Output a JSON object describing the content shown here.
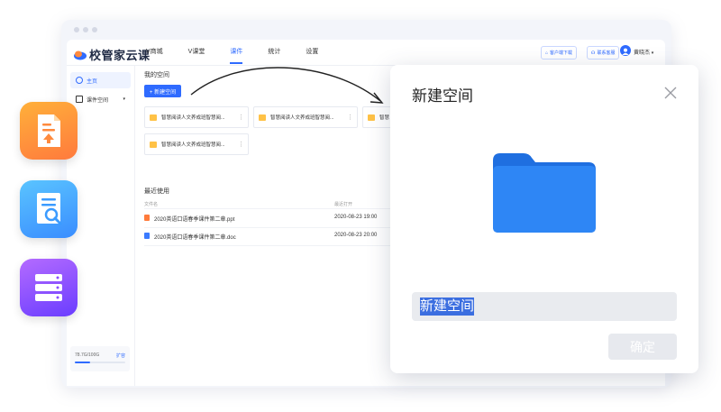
{
  "app": {
    "logo_text": "校管家云课",
    "nav": [
      "V商城",
      "V课堂",
      "课件",
      "统计",
      "设置"
    ],
    "active_nav": "课件",
    "header_buttons": {
      "download": "客户端下载",
      "contact": "联系客服"
    },
    "user_name": "黄晓杰"
  },
  "sidebar": {
    "items": [
      {
        "label": "主页",
        "active": true
      },
      {
        "label": "课件空间",
        "active": false,
        "caret": "▾"
      }
    ],
    "storage": {
      "text": "78.7G/100G",
      "link": "扩容",
      "used_fraction": 0.3
    }
  },
  "main": {
    "my_space_title": "我的空间",
    "new_space_button": "+ 新建空间",
    "cards": [
      {
        "name": "智慧阅读人文养成班智慧阅...",
        "more": "⋮"
      },
      {
        "name": "智慧阅读人文养成班智慧阅...",
        "more": "⋮"
      },
      {
        "name": "智慧",
        "more": ""
      },
      {
        "name": "智慧阅读人文养成班智慧阅...",
        "more": "⋮"
      }
    ],
    "recent_title": "最近使用",
    "columns": {
      "file_name": "文件名",
      "last_opened": "最近打开"
    },
    "recent_files": [
      {
        "name": "2020英语口语春季课件第二章.ppt",
        "time": "2020-08-23  19:00",
        "type": "ppt"
      },
      {
        "name": "2020英语口语春季课件第二章.doc",
        "time": "2020-08-23  20:00",
        "type": "doc"
      }
    ]
  },
  "modal": {
    "title": "新建空间",
    "input_value": "新建空间",
    "confirm_button": "确定"
  },
  "colors": {
    "accent": "#2f6bff",
    "tile_orange": "#ff8a3d",
    "tile_blue": "#3b9bff",
    "tile_purple": "#8a4dff",
    "folder_blue": "#2e86f5"
  },
  "icons": [
    "file-upload-icon",
    "document-search-icon",
    "server-icon",
    "folder-icon",
    "close-icon"
  ]
}
